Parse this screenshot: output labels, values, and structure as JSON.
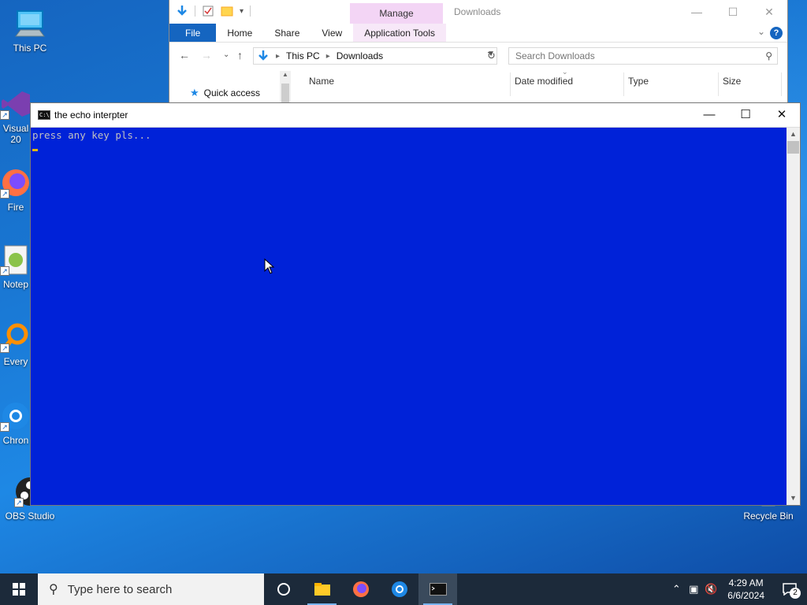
{
  "desktop": {
    "icons": [
      {
        "label": "This PC",
        "icon": "this-pc-icon"
      },
      {
        "label": "Visual\n20",
        "icon": "visual-studio-icon"
      },
      {
        "label": "Fire",
        "icon": "firefox-icon"
      },
      {
        "label": "Notep",
        "icon": "notepad-icon"
      },
      {
        "label": "Every",
        "icon": "everything-icon"
      },
      {
        "label": "Chron",
        "icon": "chrome-icon"
      },
      {
        "label": "OBS Studio",
        "icon": "obs-icon"
      },
      {
        "label": "Recycle Bin",
        "icon": "recycle-bin-icon"
      }
    ]
  },
  "explorer": {
    "title": "Downloads",
    "manage_tab": "Manage",
    "tabs": [
      "File",
      "Home",
      "Share",
      "View",
      "Application Tools"
    ],
    "breadcrumb": [
      "This PC",
      "Downloads"
    ],
    "search_placeholder": "Search Downloads",
    "sidebar": {
      "quick_access": "Quick access"
    },
    "columns": [
      "Name",
      "Date modified",
      "Type",
      "Size"
    ],
    "window_controls": [
      "minimize",
      "maximize",
      "close"
    ]
  },
  "console": {
    "title": "the echo interpter",
    "output": "press any key pls...",
    "window_controls": [
      "minimize",
      "maximize",
      "close"
    ],
    "background_color": "#0022d8",
    "text_color": "#c0c0c0"
  },
  "taskbar": {
    "search_placeholder": "Type here to search",
    "pinned": [
      "cortana-icon",
      "file-explorer-icon",
      "firefox-icon",
      "chrome-icon",
      "console-icon"
    ],
    "active_app": "console-icon",
    "clock": {
      "time": "4:29 AM",
      "date": "6/6/2024"
    },
    "notification_count": "2"
  },
  "colors": {
    "accent": "#1565c0",
    "taskbar": "#1c2a3a",
    "manage_tab": "#f3d5f5"
  }
}
